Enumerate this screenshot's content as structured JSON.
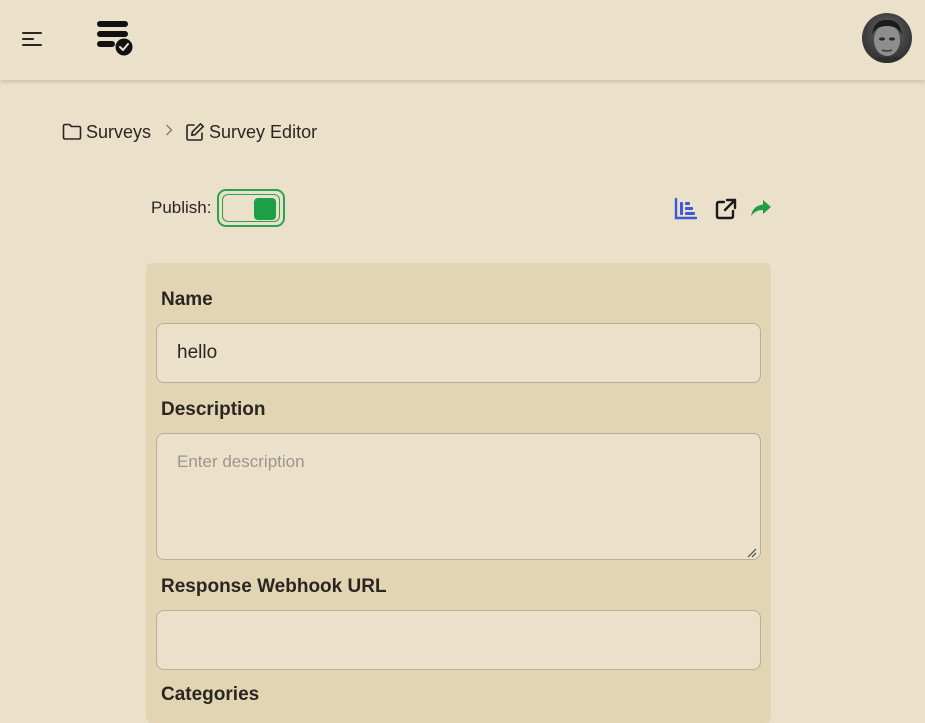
{
  "header": {
    "menu_icon": "hamburger-menu-icon",
    "logo_icon": "survey-list-check-icon",
    "avatar_icon": "user-avatar"
  },
  "breadcrumb": {
    "items": [
      {
        "label": "Surveys",
        "icon": "folder-icon"
      },
      {
        "label": "Survey Editor",
        "icon": "edit-icon"
      }
    ],
    "separator_icon": "chevron-right-icon"
  },
  "publish": {
    "label": "Publish:",
    "enabled": true,
    "color": "#1e9e46"
  },
  "actions": [
    {
      "icon": "bar-chart-icon",
      "color": "#3a5bd9"
    },
    {
      "icon": "external-link-icon",
      "color": "#1b1b1b"
    },
    {
      "icon": "share-icon",
      "color": "#1e9e46"
    }
  ],
  "form": {
    "name_label": "Name",
    "name_value": "hello",
    "description_label": "Description",
    "description_placeholder": "Enter description",
    "description_value": "",
    "webhook_label": "Response Webhook URL",
    "webhook_value": "",
    "categories_label": "Categories"
  },
  "colors": {
    "background": "#ebe1ca",
    "card": "#e2d5b3",
    "accent_green": "#1e9e46",
    "accent_blue": "#3a5bd9"
  }
}
